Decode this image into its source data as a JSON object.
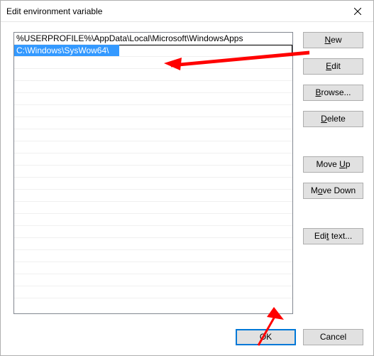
{
  "window": {
    "title": "Edit environment variable"
  },
  "list": {
    "rows": [
      {
        "value": "%USERPROFILE%\\AppData\\Local\\Microsoft\\WindowsApps",
        "selected": false,
        "editing": false
      },
      {
        "value": "C:\\Windows\\SysWow64\\",
        "selected": true,
        "editing": true
      }
    ]
  },
  "buttons": {
    "new": "New",
    "edit": "Edit",
    "browse": "Browse...",
    "delete": "Delete",
    "move_up": "Move Up",
    "move_down": "Move Down",
    "edit_text": "Edit text...",
    "ok": "OK",
    "cancel": "Cancel"
  }
}
